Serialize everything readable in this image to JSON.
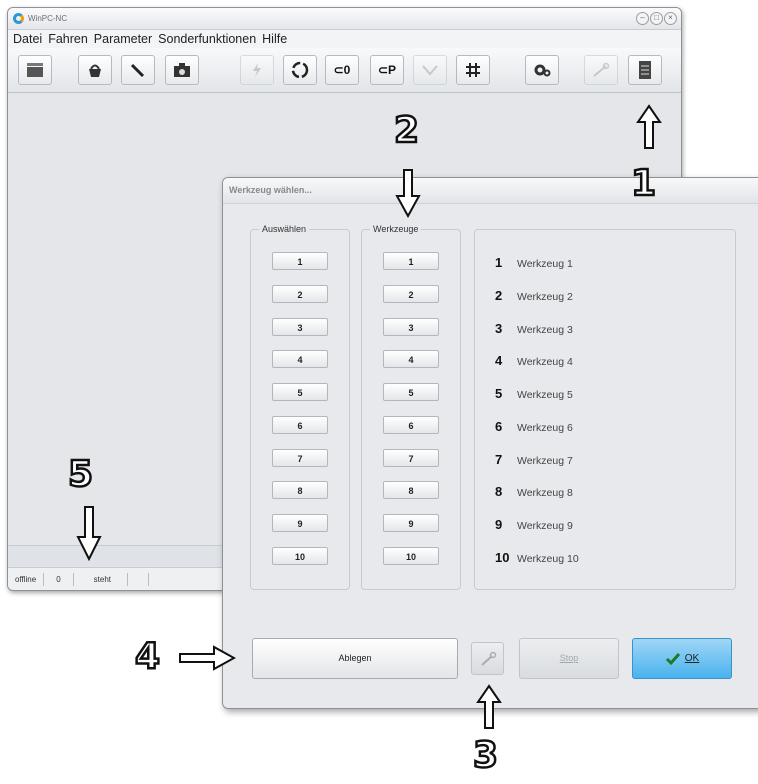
{
  "main_window": {
    "title": "WinPC-NC",
    "menu": [
      "Datei",
      "Fahren",
      "Parameter",
      "Sonderfunktionen",
      "Hilfe"
    ],
    "toolbar_icons": [
      "film-icon",
      "basket-icon",
      "brush-icon",
      "camera-icon",
      "lightning-icon",
      "refresh-icon",
      "set-zero-icon",
      "set-park-icon",
      "measure-icon",
      "grid-icon",
      "gears-icon",
      "wrench-icon",
      "tool-magazine-icon"
    ],
    "toolbar_labels": {
      "set_zero": "⊂0",
      "set_park": "⊂P"
    },
    "status": [
      "offline",
      "0",
      "steht"
    ]
  },
  "dialog": {
    "title": "Werkzeug wählen...",
    "group_select_label": "Auswählen",
    "group_tools_label": "Werkzeuge",
    "select_buttons": [
      "1",
      "2",
      "3",
      "4",
      "5",
      "6",
      "7",
      "8",
      "9",
      "10"
    ],
    "tool_buttons": [
      "1",
      "2",
      "3",
      "4",
      "5",
      "6",
      "7",
      "8",
      "9",
      "10"
    ],
    "tools": [
      {
        "num": "1",
        "name": "Werkzeug 1"
      },
      {
        "num": "2",
        "name": "Werkzeug 2"
      },
      {
        "num": "3",
        "name": "Werkzeug 3"
      },
      {
        "num": "4",
        "name": "Werkzeug 4"
      },
      {
        "num": "5",
        "name": "Werkzeug 5"
      },
      {
        "num": "6",
        "name": "Werkzeug 6"
      },
      {
        "num": "7",
        "name": "Werkzeug 7"
      },
      {
        "num": "8",
        "name": "Werkzeug 8"
      },
      {
        "num": "9",
        "name": "Werkzeug 9"
      },
      {
        "num": "10",
        "name": "Werkzeug 10"
      }
    ],
    "drop_button": "Ablegen",
    "stop_button": "Stop",
    "ok_button": "OK"
  },
  "annotations": [
    "1",
    "2",
    "3",
    "4",
    "5"
  ],
  "colors": {
    "ok_accent": "#49b3ee",
    "logo_blue": "#2b9ad3"
  }
}
